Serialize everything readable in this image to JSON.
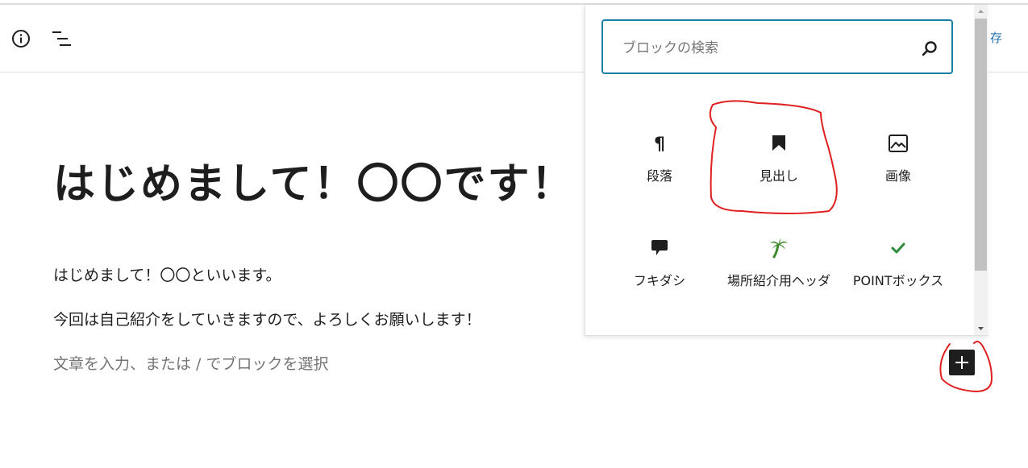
{
  "toolbar": {
    "info_icon": "info-icon",
    "outline_icon": "list-view-icon",
    "save_label": "存"
  },
  "post": {
    "title": "はじめまして！〇〇です！",
    "paragraphs": [
      "はじめまして！〇〇といいます。",
      "今回は自己紹介をしていきますので、よろしくお願いします！"
    ],
    "placeholder": "文章を入力、または / でブロックを選択"
  },
  "inserter": {
    "search_placeholder": "ブロックの検索",
    "blocks": [
      {
        "label": "段落",
        "icon": "paragraph-icon"
      },
      {
        "label": "見出し",
        "icon": "bookmark-icon"
      },
      {
        "label": "画像",
        "icon": "image-icon"
      },
      {
        "label": "フキダシ",
        "icon": "speech-bubble-icon"
      },
      {
        "label": "場所紹介用ヘッダ",
        "icon": "palm-tree-icon"
      },
      {
        "label": "POINTボックス",
        "icon": "check-icon"
      }
    ],
    "toggle_icon": "plus-icon"
  },
  "colors": {
    "accent": "#2271b1",
    "search_border": "#1a7fa5",
    "palm_green": "#3a8a2a",
    "check_green": "#2e8b3a",
    "annotation_red": "#e02020"
  }
}
